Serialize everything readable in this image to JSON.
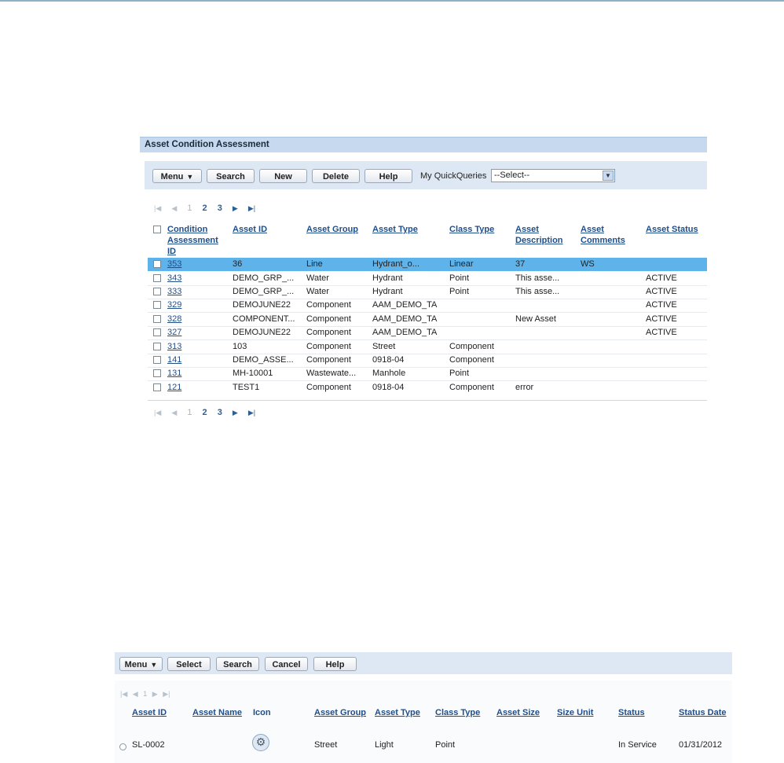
{
  "assessment_panel": {
    "title": "Asset Condition Assessment",
    "toolbar": {
      "menu": "Menu",
      "search": "Search",
      "new": "New",
      "delete": "Delete",
      "help": "Help",
      "quickqueries_label": "My QuickQueries",
      "quickqueries_value": "--Select--"
    },
    "pager": {
      "pages": [
        "1",
        "2",
        "3"
      ],
      "current_page": "1"
    },
    "columns": {
      "id_line1": "Condition",
      "id_line2": "Assessment",
      "id_line3": "ID",
      "asset_id": "Asset ID",
      "asset_group": "Asset Group",
      "asset_type": "Asset Type",
      "class_type": "Class Type",
      "desc_line1": "Asset",
      "desc_line2": "Description",
      "comm_line1": "Asset",
      "comm_line2": "Comments",
      "asset_status": "Asset Status"
    },
    "rows": [
      {
        "id": "353",
        "asset_id": "36",
        "group": "Line",
        "type": "Hydrant_o...",
        "class": "Linear",
        "desc": "37",
        "comments": "WS",
        "status": ""
      },
      {
        "id": "343",
        "asset_id": "DEMO_GRP_...",
        "group": "Water",
        "type": "Hydrant",
        "class": "Point",
        "desc": "This asse...",
        "comments": "",
        "status": "ACTIVE"
      },
      {
        "id": "333",
        "asset_id": "DEMO_GRP_...",
        "group": "Water",
        "type": "Hydrant",
        "class": "Point",
        "desc": "This asse...",
        "comments": "",
        "status": "ACTIVE"
      },
      {
        "id": "329",
        "asset_id": "DEMOJUNE22",
        "group": "Component",
        "type": "AAM_DEMO_TA",
        "class": "",
        "desc": "",
        "comments": "",
        "status": "ACTIVE"
      },
      {
        "id": "328",
        "asset_id": "COMPONENT...",
        "group": "Component",
        "type": "AAM_DEMO_TA",
        "class": "",
        "desc": "New Asset",
        "comments": "",
        "status": "ACTIVE"
      },
      {
        "id": "327",
        "asset_id": "DEMOJUNE22",
        "group": "Component",
        "type": "AAM_DEMO_TA",
        "class": "",
        "desc": "",
        "comments": "",
        "status": "ACTIVE"
      },
      {
        "id": "313",
        "asset_id": "103",
        "group": "Component",
        "type": "Street",
        "class": "Component",
        "desc": "",
        "comments": "",
        "status": ""
      },
      {
        "id": "141",
        "asset_id": "DEMO_ASSE...",
        "group": "Component",
        "type": "0918-04",
        "class": "Component",
        "desc": "",
        "comments": "",
        "status": ""
      },
      {
        "id": "131",
        "asset_id": "MH-10001",
        "group": "Wastewate...",
        "type": "Manhole",
        "class": "Point",
        "desc": "",
        "comments": "",
        "status": ""
      },
      {
        "id": "121",
        "asset_id": "TEST1",
        "group": "Component",
        "type": "0918-04",
        "class": "Component",
        "desc": "error",
        "comments": "",
        "status": ""
      }
    ]
  },
  "select_panel": {
    "toolbar": {
      "menu": "Menu",
      "select": "Select",
      "search": "Search",
      "cancel": "Cancel",
      "help": "Help"
    },
    "pager": {
      "pages": [
        "1"
      ]
    },
    "columns": {
      "asset_id": "Asset ID",
      "asset_name": "Asset Name",
      "icon": "Icon",
      "asset_group": "Asset Group",
      "asset_type": "Asset Type",
      "class_type": "Class Type",
      "asset_size": "Asset Size",
      "size_unit": "Size Unit",
      "status": "Status",
      "status_date": "Status Date"
    },
    "rows": [
      {
        "asset_id": "SL-0002",
        "asset_name": "",
        "icon": "gear-icon",
        "group": "Street",
        "type": "Light",
        "class": "Point",
        "size": "",
        "unit": "",
        "status": "In Service",
        "status_date": "01/31/2012"
      }
    ]
  }
}
